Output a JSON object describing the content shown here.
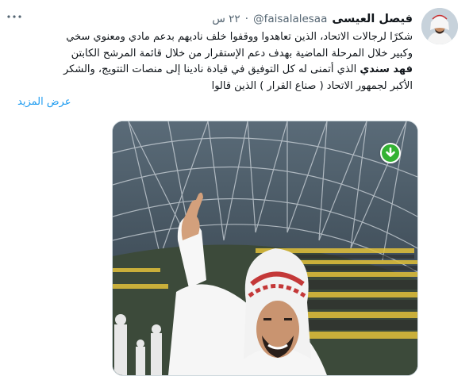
{
  "tweet": {
    "author_name": "فيصل العيسى",
    "handle": "@faisalalesaa",
    "separator": "·",
    "time": "٢٢ س",
    "more_icon": "ellipsis-icon",
    "text_line1": "شكرًا لرجالات الاتحاد، الذين تعاهدوا ووقفوا خلف ناديهم بدعم مادي ومعنوي سخي",
    "text_line2": "وكبير خلال المرحلة الماضية بهدف دعم الإستقرار من خلال قائمة المرشح الكابتن",
    "text_bold": "فهد سندي",
    "text_line3_rest": " الذي أتمنى له كل التوفيق في قيادة نادينا إلى منصات التتويج، والشكر",
    "text_line4": "الأكبر لجمهور الاتحاد ( صناع القرار ) الذين قالوا",
    "show_more": "عرض المزيد"
  },
  "media": {
    "kind": "photo",
    "download_icon": "download-arrow-icon",
    "download_color": "#34b233"
  }
}
